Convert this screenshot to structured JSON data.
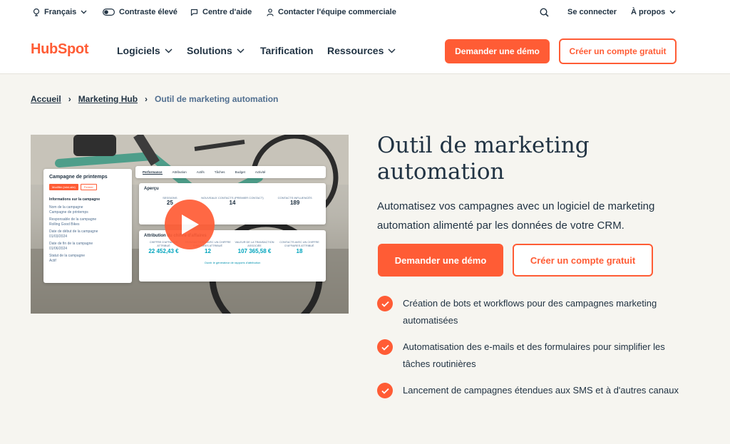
{
  "utility": {
    "language": "Français",
    "contrast": "Contraste élevé",
    "help": "Centre d'aide",
    "sales": "Contacter l'équipe commerciale",
    "login": "Se connecter",
    "about": "À propos"
  },
  "nav": {
    "logo": "HubSpot",
    "items": [
      "Logiciels",
      "Solutions",
      "Tarification",
      "Ressources"
    ],
    "demo_button": "Demander une démo",
    "signup_button": "Créer un compte gratuit"
  },
  "breadcrumb": {
    "home": "Accueil",
    "hub": "Marketing Hub",
    "current": "Outil de marketing automation"
  },
  "hero": {
    "title_line1": "Outil de marketing",
    "title_line2": "automation",
    "description": "Automatisez vos campagnes avec un logiciel de marketing automation alimenté par les données de votre CRM.",
    "demo_button": "Demander une démo",
    "signup_button": "Créer un compte gratuit",
    "features": [
      "Création de bots et workflows pour des campagnes marketing automatisées",
      "Automatisation des e-mails et des formulaires pour simplifier les tâches routinières",
      "Lancement de campagnes étendues aux SMS et à d'autres canaux"
    ]
  },
  "video_mock": {
    "campaign_title": "Campagne de printemps",
    "tabs": [
      "Performance",
      "Attribution",
      "Actifs",
      "Tâches",
      "Budget",
      "Activité"
    ],
    "apercu": "Aperçu",
    "sessions_label": "SESSIONS",
    "sessions_value": "25",
    "new_contacts_label": "NOUVEAUX CONTACTS (PREMIER CONTACT)",
    "new_contacts_value": "14",
    "influenced_label": "CONTACTS INFLUENCÉS",
    "influenced_value": "189",
    "attribution_title": "Attribution du chiffre d'affaires",
    "revenue_label": "CHIFFRE D'AFFAIRES ATTRIBUÉ",
    "revenue_value": "22 452,43 €",
    "deals_label": "TRANSACTIONS AVEC UN CHIFFRE D'AFFAIRES ATTRIBUÉ",
    "deals_value": "12",
    "deal_value_label": "VALEUR DE LA TRANSACTION ASSOCIÉE",
    "deal_value_value": "107 365,58 €",
    "contacts_rev_label": "CONTACTS AVEC UN CHIFFRE D'AFFAIRES ATTRIBUÉ",
    "contacts_rev_value": "18",
    "report_link": "Ouvrir le générateur de rapports d'attribution",
    "info_title": "Informations sur la campagne",
    "info_lines": [
      "Nom de la campagne",
      "Campagne de printemps",
      "Responsable de la campagne",
      "Rolling Good Bikes",
      "Date de début de la campagne",
      "01/03/2024",
      "Date de fin de la campagne",
      "01/06/2024",
      "Statut de la campagne",
      "Actif"
    ],
    "action_button": "Modifier (mini-site)",
    "close_button": "Fermer"
  },
  "colors": {
    "accent": "#ff5c35",
    "text": "#213343",
    "background": "#f6f5f0",
    "teal": "#00a4bd"
  }
}
